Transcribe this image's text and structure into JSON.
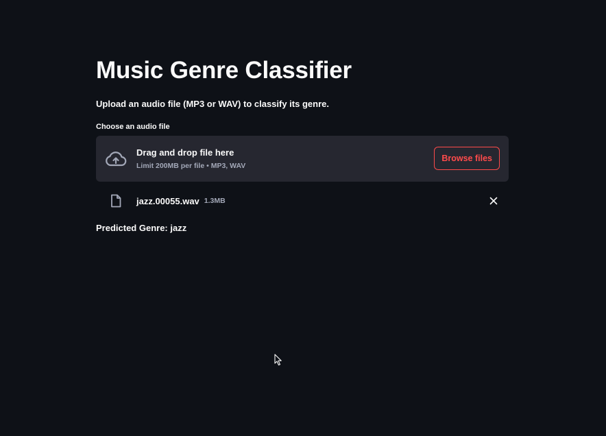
{
  "page": {
    "title": "Music Genre Classifier",
    "subtitle": "Upload an audio file (MP3 or WAV) to classify its genre."
  },
  "uploader": {
    "label": "Choose an audio file",
    "drop_text": "Drag and drop file here",
    "limit_text": "Limit 200MB per file • MP3, WAV",
    "browse_label": "Browse files",
    "icon": "cloud-upload-icon"
  },
  "uploaded_file": {
    "name": "jazz.00055.wav",
    "size": "1.3MB",
    "icon": "file-icon",
    "remove_icon": "close-icon"
  },
  "result": {
    "text": "Predicted Genre: jazz"
  },
  "colors": {
    "background": "#0e1117",
    "surface": "#262730",
    "accent": "#ff4b4b",
    "text": "#fafafa",
    "muted": "#a3a8b8"
  }
}
